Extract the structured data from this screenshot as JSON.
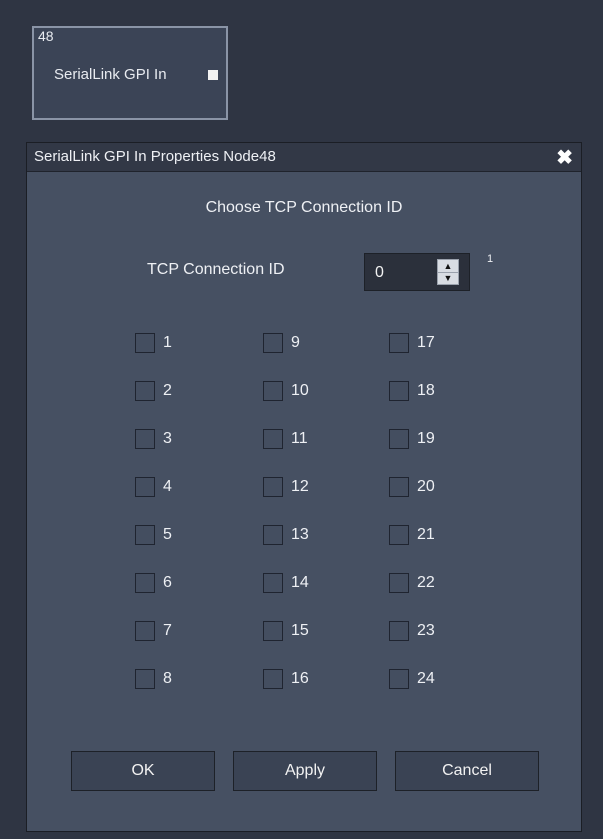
{
  "node": {
    "id": "48",
    "title": "SerialLink GPI In"
  },
  "dialog": {
    "title": "SerialLink GPI In Properties Node48",
    "close_glyph": "✖",
    "heading": "Choose TCP Connection ID",
    "tcp_label": "TCP Connection ID",
    "tcp_value": "0",
    "spin_up": "▲",
    "spin_down": "▼",
    "superscript": "1"
  },
  "checkboxes": {
    "col1": [
      "1",
      "2",
      "3",
      "4",
      "5",
      "6",
      "7",
      "8"
    ],
    "col2": [
      "9",
      "10",
      "11",
      "12",
      "13",
      "14",
      "15",
      "16"
    ],
    "col3": [
      "17",
      "18",
      "19",
      "20",
      "21",
      "22",
      "23",
      "24"
    ]
  },
  "buttons": {
    "ok": "OK",
    "apply": "Apply",
    "cancel": "Cancel"
  },
  "colors": {
    "background": "#2f3543",
    "dialog": "#465062",
    "titlebar": "#323846",
    "text": "#eef0f4"
  }
}
